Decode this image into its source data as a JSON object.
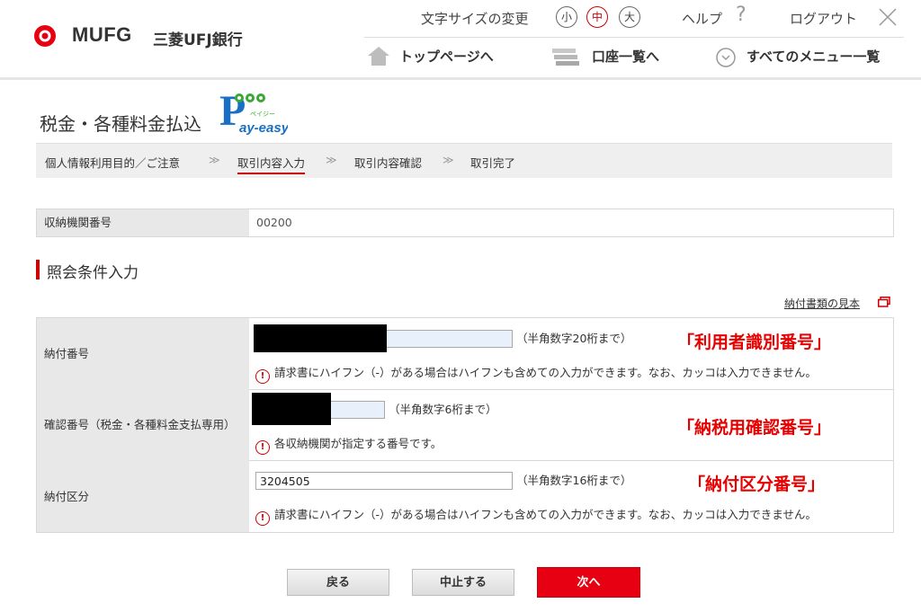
{
  "header": {
    "logo_text": "MUFG",
    "bank_name": "三菱UFJ銀行",
    "font_size_label": "文字サイズの変更",
    "font_sizes": [
      "小",
      "中",
      "大"
    ],
    "help_label": "ヘルプ",
    "logout_label": "ログアウト",
    "nav": {
      "top_page": "トップページへ",
      "accounts": "口座一覧へ",
      "all_menu": "すべてのメニュー一覧"
    }
  },
  "page": {
    "title": "税金・各種料金払込",
    "payeasy_text": "ay-easy",
    "payeasy_kana": "ペイジー"
  },
  "steps": {
    "items": [
      "個人情報利用目的／ご注意",
      "取引内容入力",
      "取引内容確認",
      "取引完了"
    ],
    "separator": "≫",
    "active_index": 1
  },
  "org": {
    "label": "収納機関番号",
    "value": "00200"
  },
  "section": {
    "title": "照会条件入力",
    "sample_link": "納付書類の見本"
  },
  "form": {
    "rows": [
      {
        "label": "納付番号",
        "value": "",
        "hint": "（半角数字20桁まで）",
        "note": "請求書にハイフン（-）がある場合はハイフンも含めての入力ができます。なお、カッコは入力できません。",
        "annotation": "「利用者識別番号」"
      },
      {
        "label": "確認番号（税金・各種料金支払専用）",
        "value": "",
        "hint": "（半角数字6桁まで）",
        "note": "各収納機関が指定する番号です。",
        "annotation": "「納税用確認番号」"
      },
      {
        "label": "納付区分",
        "value": "3204505",
        "hint": "（半角数字16桁まで）",
        "note": "請求書にハイフン（-）がある場合はハイフンも含めての入力ができます。なお、カッコは入力できません。",
        "annotation": "「納付区分番号」"
      }
    ],
    "warn_icon_char": "!"
  },
  "buttons": {
    "back": "戻る",
    "cancel": "中止する",
    "next": "次へ"
  },
  "colors": {
    "accent": "#e60012",
    "annotation": "#e60000",
    "label_bg": "#e8e8e8"
  }
}
